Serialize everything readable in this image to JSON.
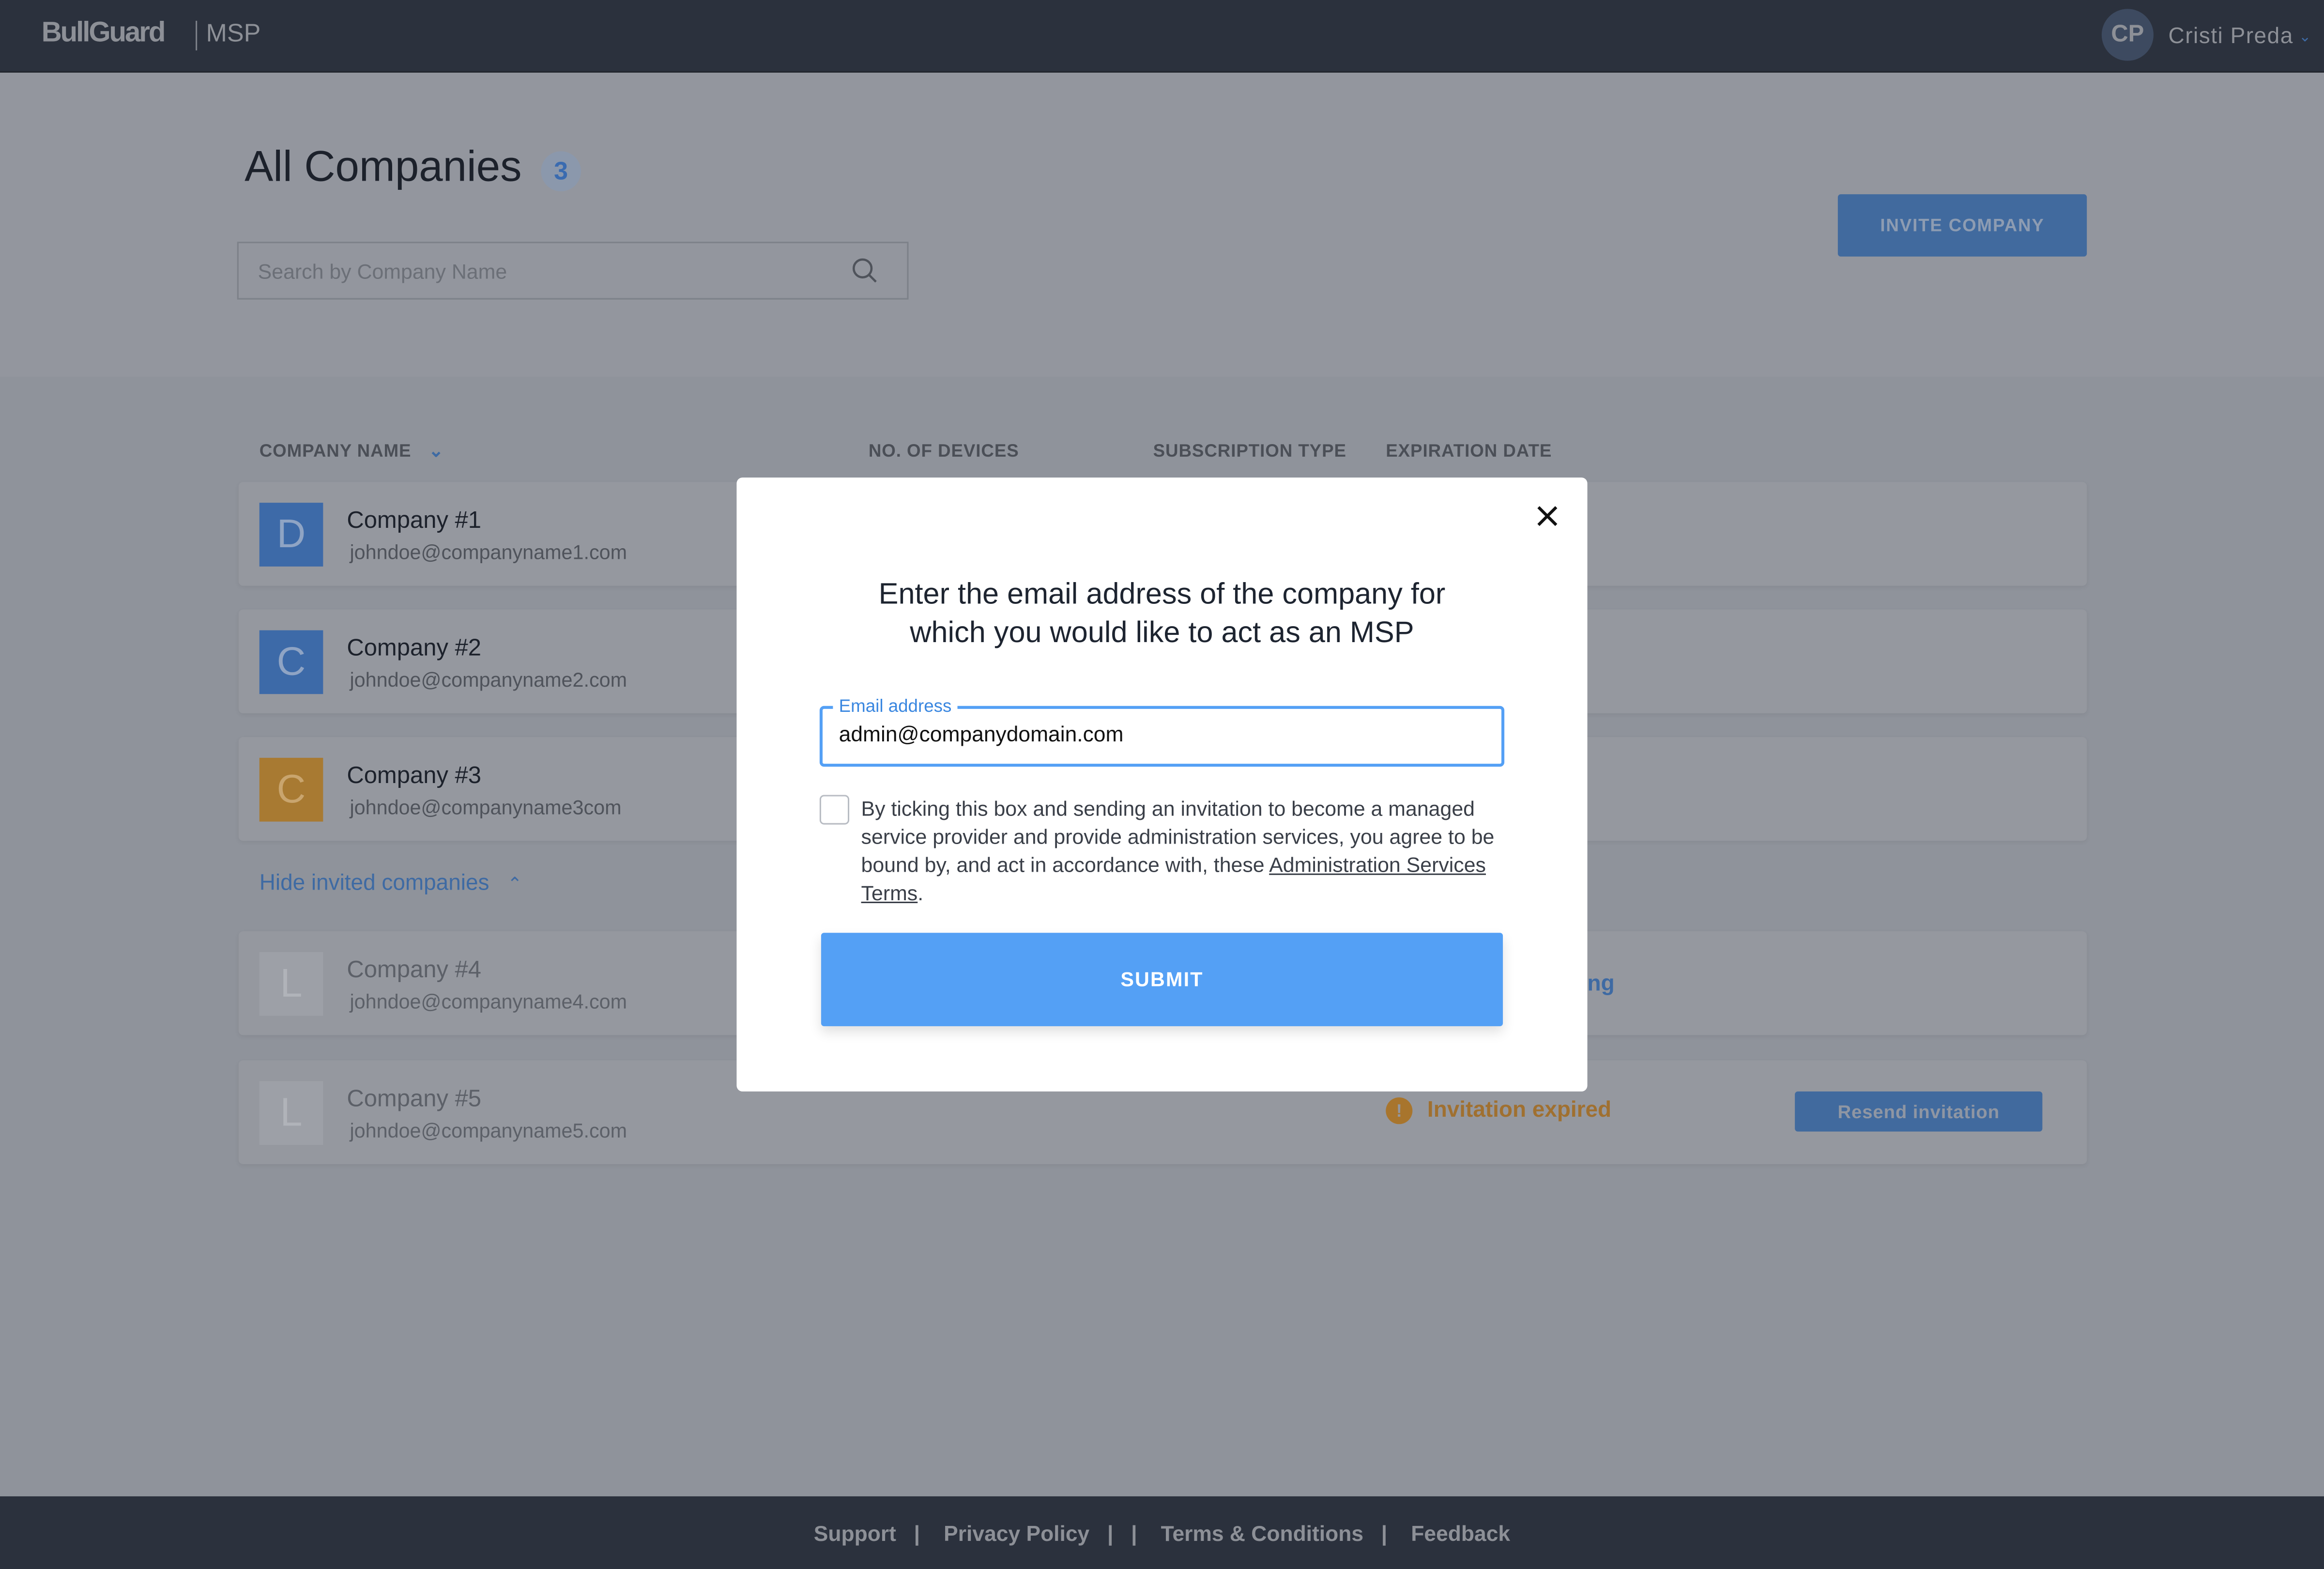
{
  "header": {
    "logo": "BullGuard",
    "product": "MSP",
    "avatar_initials": "CP",
    "user_name": "Cristi Preda"
  },
  "page": {
    "title": "All Companies",
    "count": "3",
    "search_placeholder": "Search by Company Name",
    "invite_label": "INVITE COMPANY"
  },
  "table": {
    "columns": [
      "COMPANY NAME",
      "NO. OF DEVICES",
      "SUBSCRIPTION TYPE",
      "EXPIRATION DATE"
    ],
    "rows": [
      {
        "letter": "D",
        "name": "Company  #1",
        "email": "johndoe@companyname1.com",
        "color": "#3d6aa8"
      },
      {
        "letter": "C",
        "name": "Company #2",
        "email": "johndoe@companyname2.com",
        "color": "#3d6aa8"
      },
      {
        "letter": "C",
        "name": "Company #3",
        "email": "johndoe@companyname3com",
        "color": "#a87a32"
      }
    ],
    "hide_invited_label": "Hide invited companies",
    "invited": [
      {
        "letter": "L",
        "name": "Company #4",
        "email": "johndoe@companyname4.com",
        "status_partial": "ng"
      },
      {
        "letter": "L",
        "name": "Company #5",
        "email": "johndoe@companyname5.com",
        "status": "Invitation expired",
        "action": "Resend invitation"
      }
    ]
  },
  "modal": {
    "title_line1": "Enter the email address of the company for",
    "title_line2": "which you would like to act as an MSP",
    "email_label": "Email address",
    "email_value": "admin@companydomain.com",
    "terms_text": "By ticking this box and sending an invitation to become a managed service provider and provide administration services, you agree to be bound by, and act in accordance with, these ",
    "terms_link": "Administration Services Terms",
    "terms_end": ".",
    "checked": false,
    "submit_label": "SUBMIT"
  },
  "footer": {
    "links": [
      "Support",
      "Privacy Policy",
      "Terms & Conditions",
      "Feedback"
    ],
    "separator": "|"
  },
  "colors": {
    "accent": "#54a0f5",
    "header_bg": "#2b313d",
    "warning": "#a07030"
  }
}
